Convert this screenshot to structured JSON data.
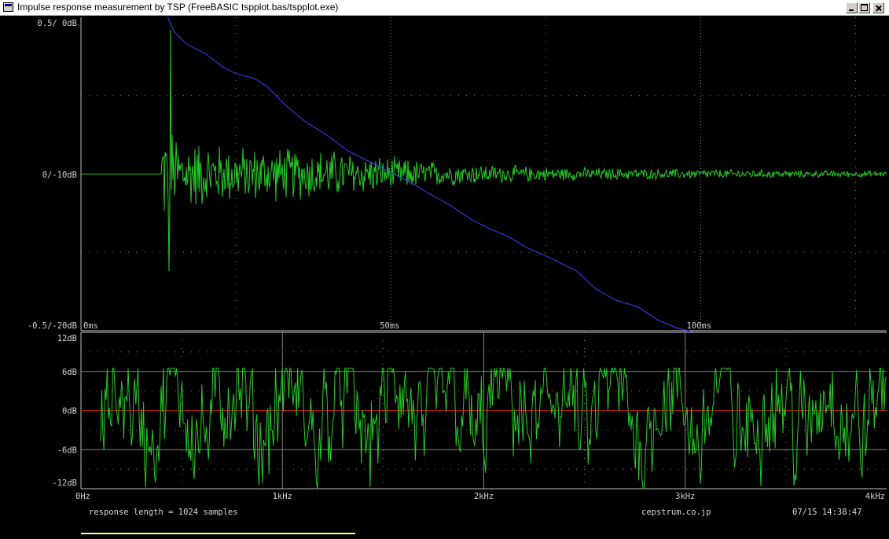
{
  "window": {
    "title": "Impulse response measurement by TSP (FreeBASIC tspplot.bas/tspplot.exe)"
  },
  "colors": {
    "background": "#000000",
    "impulse_trace": "#22cc22",
    "decay_curve": "#3344ff",
    "zero_line": "#aa1111",
    "grid": "#808080",
    "progress_bar": "#ffff88"
  },
  "chart_data": [
    {
      "type": "line",
      "title": "",
      "xlabel": "",
      "ylabel": "",
      "x_unit": "ms",
      "xlim": [
        0,
        130
      ],
      "ylim": [
        -0.5,
        0.5
      ],
      "secondary_ylim": [
        -20,
        0
      ],
      "y_tick_labels": [
        "0.5/  0dB",
        "0/-10dB",
        "-0.5/-20dB"
      ],
      "x_tick_labels": [
        "0ms",
        "50ms",
        "100ms"
      ],
      "x_ticks": [
        0,
        50,
        100
      ],
      "grid": true,
      "series": [
        {
          "axis": "amplitude",
          "onset_ms": 13,
          "peak_ms": 14.5,
          "peak_positive": 0.46,
          "peak_negative": -0.31,
          "envelope_ms": [
            13,
            16,
            25,
            40,
            50,
            60,
            75,
            90,
            110,
            130
          ],
          "envelope_amp": [
            0.2,
            0.13,
            0.1,
            0.09,
            0.06,
            0.04,
            0.025,
            0.02,
            0.015,
            0.01
          ]
        },
        {
          "axis": "decay_dB",
          "x": [
            14,
            15,
            17,
            20,
            23,
            25,
            28,
            30,
            33,
            36,
            40,
            43,
            46,
            50,
            53,
            56,
            60,
            63,
            66,
            69,
            72,
            76,
            80,
            83,
            86,
            90,
            93,
            96,
            99,
            100
          ],
          "y": [
            0,
            -0.9,
            -1.7,
            -2.3,
            -3.2,
            -3.6,
            -3.9,
            -4.4,
            -5.6,
            -6.6,
            -7.6,
            -8.5,
            -9.1,
            -9.9,
            -10.5,
            -11.2,
            -12.1,
            -12.9,
            -13.5,
            -14,
            -14.7,
            -15.4,
            -16.2,
            -17.3,
            -18,
            -18.5,
            -19.3,
            -19.8,
            -20.2,
            -20.4
          ]
        }
      ]
    },
    {
      "type": "line",
      "title": "",
      "xlabel": "",
      "ylabel": "",
      "x_unit": "kHz",
      "xlim": [
        0,
        4
      ],
      "ylim": [
        -12,
        12
      ],
      "y_ticks": [
        12,
        6,
        0,
        -6,
        -12
      ],
      "y_tick_labels": [
        "12dB",
        "6dB",
        "0dB",
        "-6dB",
        "-12dB"
      ],
      "x_ticks": [
        0,
        1,
        2,
        3,
        4
      ],
      "x_tick_labels": [
        "0Hz",
        "1kHz",
        "2kHz",
        "3kHz",
        "4kHz"
      ],
      "reference_line_dB": 0,
      "grid": true,
      "series": [
        {
          "description_points": 1024,
          "upper_envelope_dB": 6.5,
          "lower_clip_dB": -12
        }
      ]
    }
  ],
  "footer": {
    "info": "response length = 1024 samples",
    "site": "cepstrum.co.jp",
    "timestamp": "07/15 14:38:47",
    "progress": 0.34
  }
}
